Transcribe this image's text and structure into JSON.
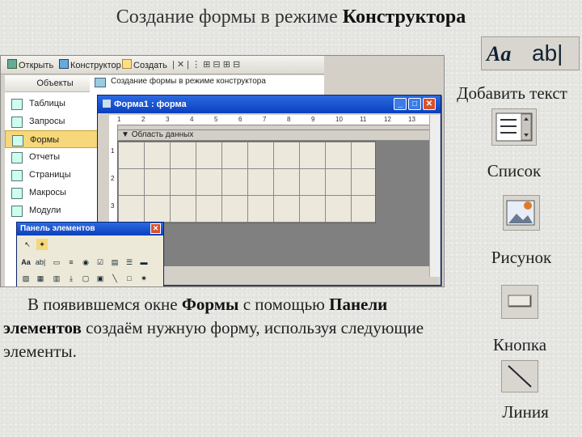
{
  "slide": {
    "title_plain": "Создание формы в режиме ",
    "title_bold": "Конструктора",
    "paragraph_part1": "В появившемся окне ",
    "paragraph_bold1": "Формы",
    "paragraph_part2": " с помощью ",
    "paragraph_bold2": "Панели элементов",
    "paragraph_part3": " создаём нужную форму, используя следующие элементы."
  },
  "elements": {
    "text_label": "Добавить текст",
    "text_icon_glyphs": [
      "Aa",
      "ab|"
    ],
    "list_label": "Список",
    "picture_label": "Рисунок",
    "button_label": "Кнопка",
    "line_label": "Линия"
  },
  "screenshot": {
    "toolbar": {
      "open": "Открыть",
      "design": "Конструктор",
      "create": "Создать"
    },
    "nav_header": "Объекты",
    "nav_items": [
      "Таблицы",
      "Запросы",
      "Формы",
      "Отчеты",
      "Страницы",
      "Макросы",
      "Модули"
    ],
    "nav_selected_index": 2,
    "object_list": [
      "Создание формы в режиме конструктора"
    ],
    "form_window_title": "Форма1 : форма",
    "section_label": "Область данных",
    "ruler_numbers": [
      "1",
      "2",
      "3",
      "4",
      "5",
      "6",
      "7",
      "8",
      "9",
      "10",
      "11",
      "12",
      "13"
    ],
    "toolbox_title": "Панель элементов",
    "toolbox_row2": [
      "Aa",
      "ab|"
    ]
  },
  "colors": {
    "titlebar": "#0a3fbf",
    "selected_item": "#f6d77a",
    "form_grid": "#ece8dc",
    "canvas_dark": "#808080"
  }
}
